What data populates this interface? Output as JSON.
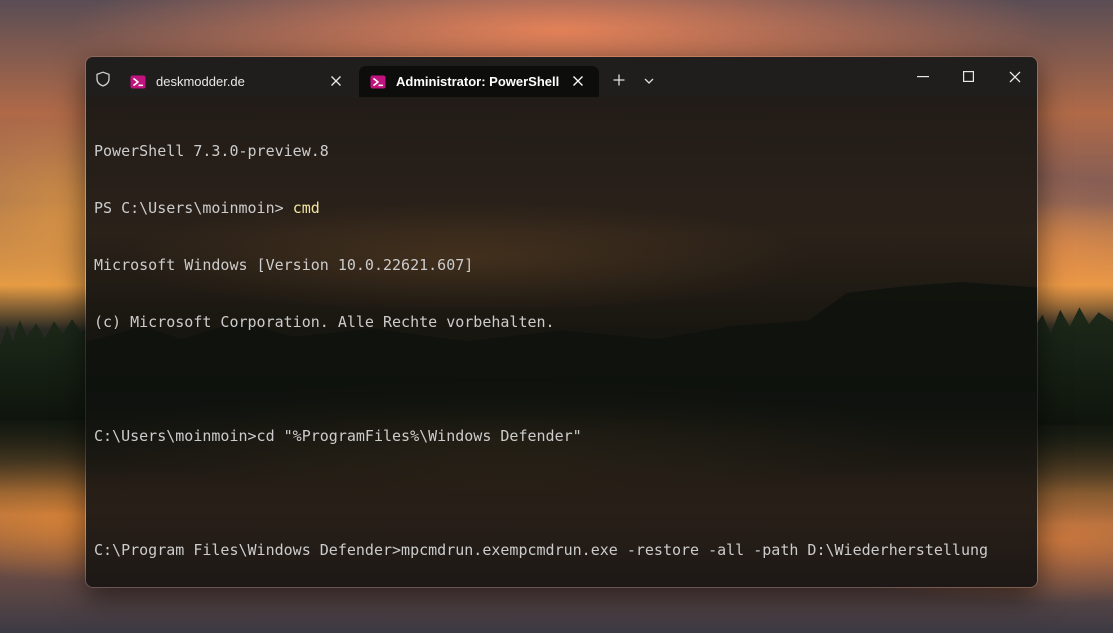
{
  "colors": {
    "titlebar_bg": "#1f1e1d",
    "active_tab_bg": "#0d0d0c",
    "console_text": "#cccccc",
    "command_highlight": "#f2e6a0",
    "powershell_icon": "#c0137e"
  },
  "titlebar": {
    "shield_icon": "shield-icon",
    "tabs": [
      {
        "label": "deskmodder.de",
        "icon": "powershell-icon",
        "active": false
      },
      {
        "label": "Administrator: PowerShell",
        "icon": "powershell-icon",
        "active": true
      }
    ],
    "new_tab_icon": "plus-icon",
    "dropdown_icon": "chevron-down-icon",
    "window_controls": [
      "minimize-icon",
      "maximize-icon",
      "close-icon"
    ]
  },
  "console": {
    "lines": [
      {
        "text": "PowerShell 7.3.0-preview.8"
      },
      {
        "prompt": "PS C:\\Users\\moinmoin> ",
        "command": "cmd"
      },
      {
        "text": "Microsoft Windows [Version 10.0.22621.607]"
      },
      {
        "text": "(c) Microsoft Corporation. Alle Rechte vorbehalten."
      },
      {
        "text": ""
      },
      {
        "text": "C:\\Users\\moinmoin>cd \"%ProgramFiles%\\Windows Defender\""
      },
      {
        "text": ""
      },
      {
        "text": "C:\\Program Files\\Windows Defender>mpcmdrun.exempcmdrun.exe -restore -all -path D:\\Wiederherstellung"
      }
    ]
  }
}
